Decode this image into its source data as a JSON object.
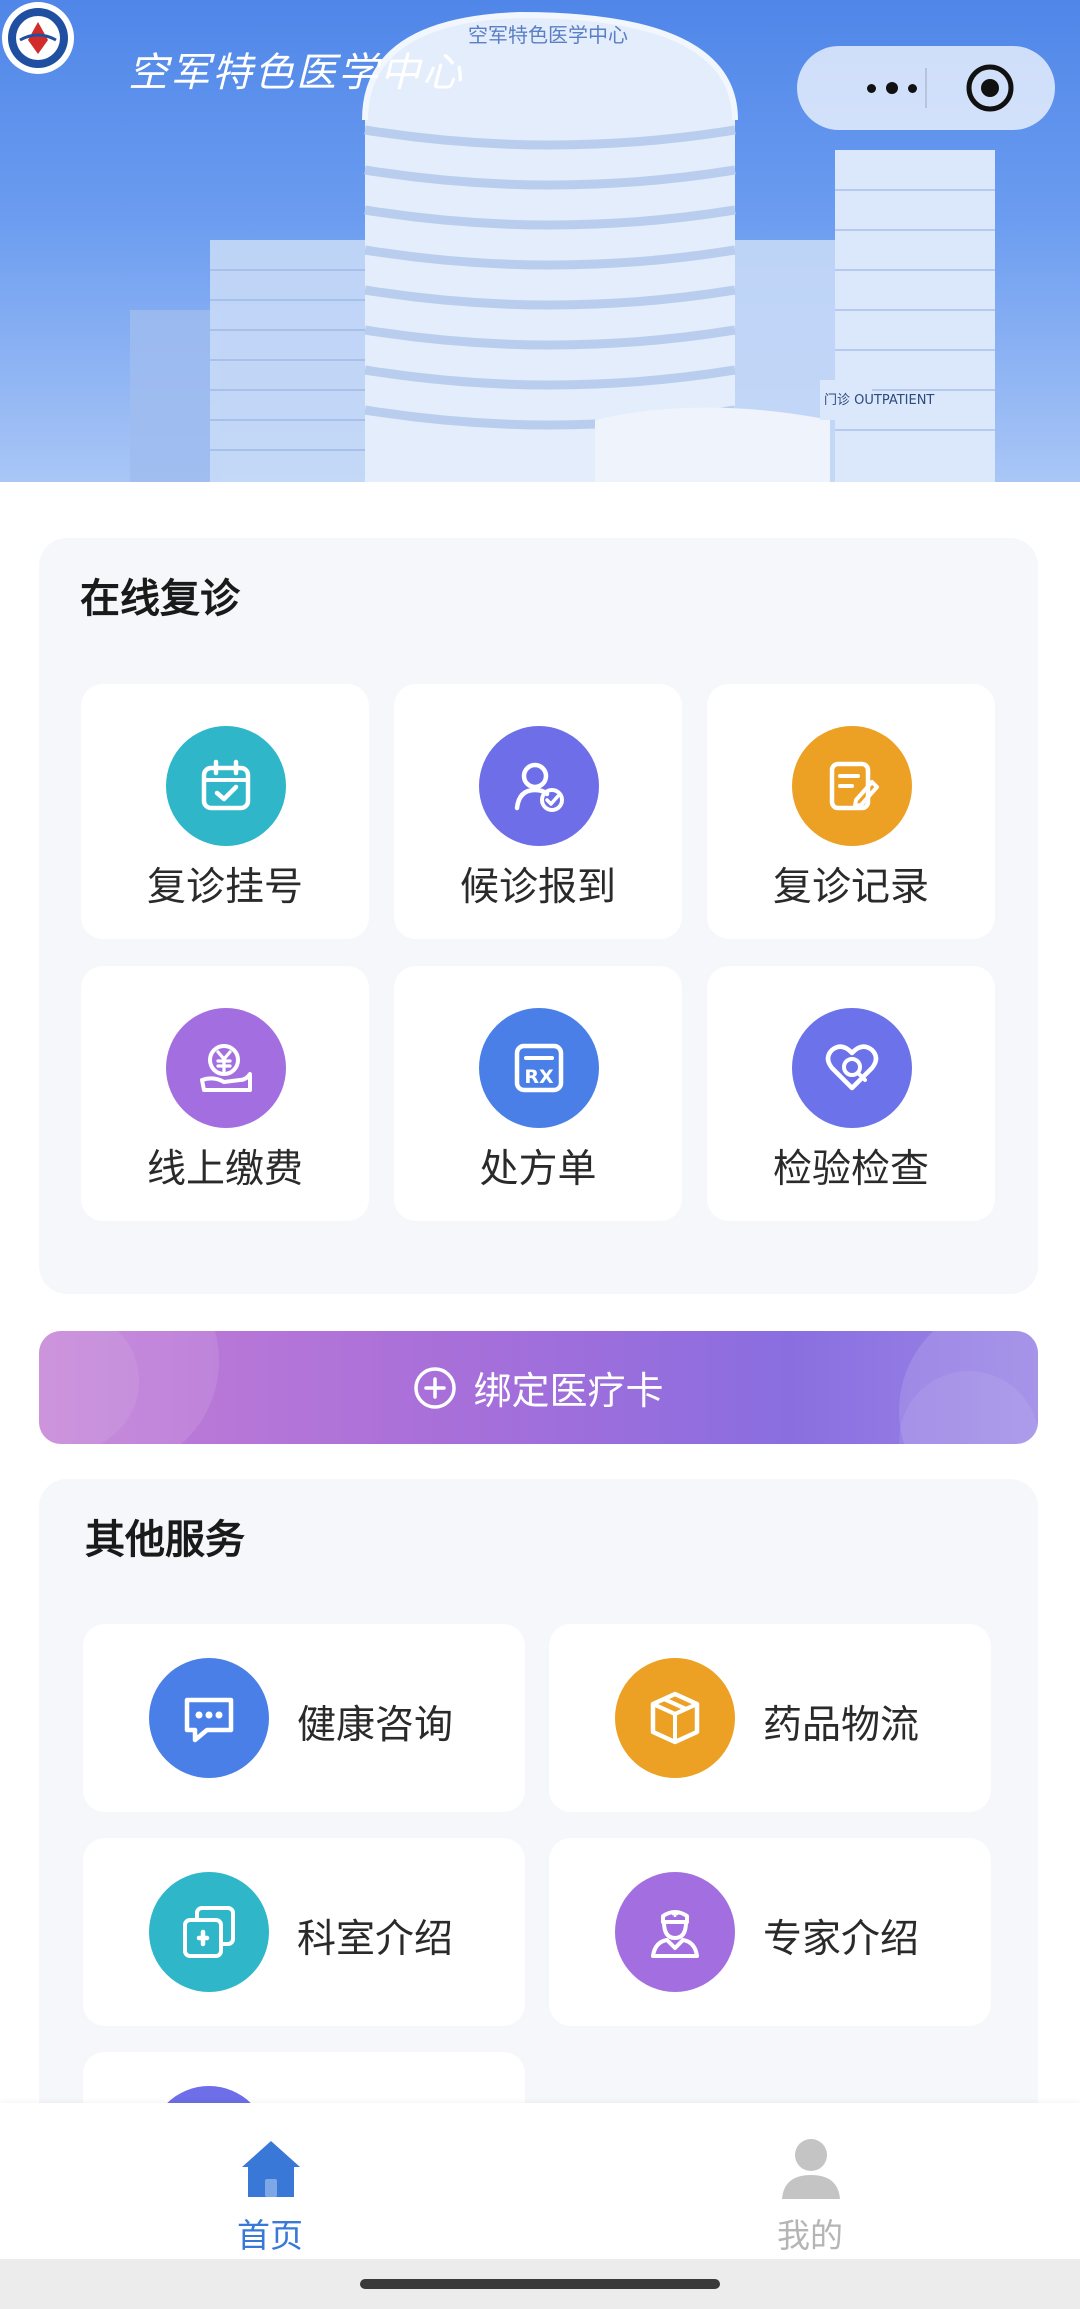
{
  "header": {
    "logo_text": "空军特色医学中心",
    "banner_sign": "空军特色医学中心",
    "entrance_sign": "门诊 OUTPATIENT"
  },
  "online_revisit": {
    "title": "在线复诊",
    "items": [
      {
        "label": "复诊挂号",
        "icon": "calendar-check-icon",
        "color": "#2fb6c9"
      },
      {
        "label": "候诊报到",
        "icon": "user-check-icon",
        "color": "#6d6ee8"
      },
      {
        "label": "复诊记录",
        "icon": "record-edit-icon",
        "color": "#eca124"
      },
      {
        "label": "线上缴费",
        "icon": "yuan-hand-icon",
        "color": "#a36fe0"
      },
      {
        "label": "处方单",
        "icon": "prescription-rx-icon",
        "color": "#4b7fe8"
      },
      {
        "label": "检验检查",
        "icon": "heart-search-icon",
        "color": "#6b72ea"
      }
    ]
  },
  "bind_card": {
    "label": "绑定医疗卡"
  },
  "other_services": {
    "title": "其他服务",
    "items": [
      {
        "label": "健康咨询",
        "icon": "chat-bubble-icon",
        "color": "#4b7fe8"
      },
      {
        "label": "药品物流",
        "icon": "package-box-icon",
        "color": "#eca124"
      },
      {
        "label": "科室介绍",
        "icon": "medical-cross-icon",
        "color": "#2fb6c9"
      },
      {
        "label": "专家介绍",
        "icon": "doctor-icon",
        "color": "#a36fe0"
      }
    ]
  },
  "tabbar": {
    "tabs": [
      {
        "label": "首页",
        "icon": "home-icon",
        "active": true,
        "color": "#3a78d8"
      },
      {
        "label": "我的",
        "icon": "user-icon",
        "active": false,
        "color": "#b5b5b5"
      }
    ]
  }
}
